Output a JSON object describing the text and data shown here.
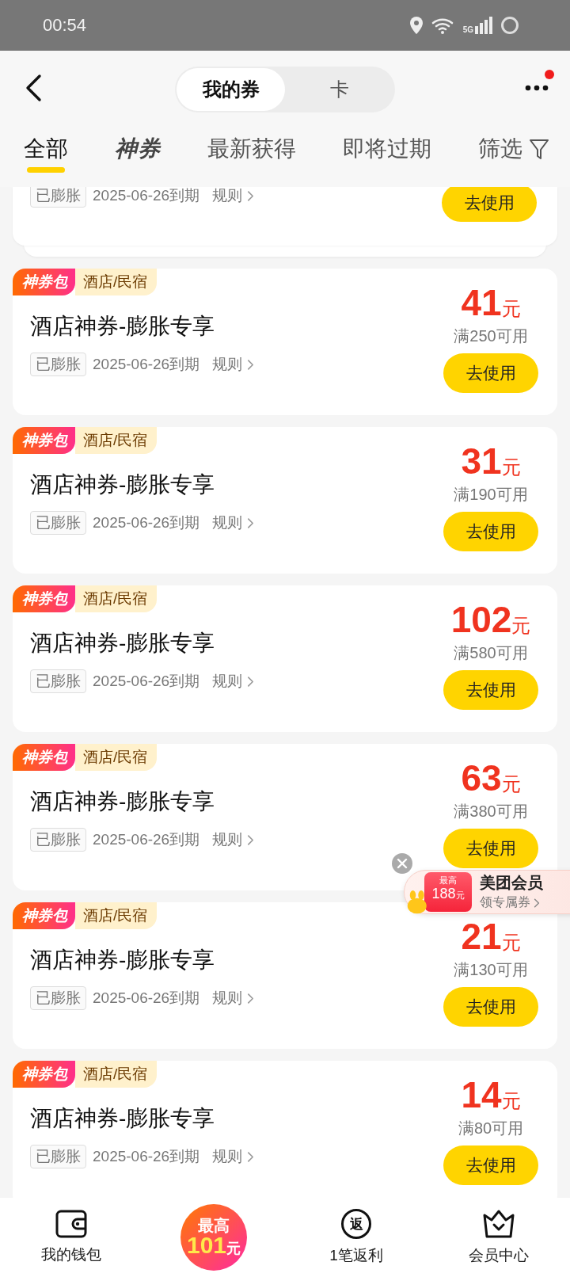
{
  "status_bar": {
    "time": "00:54",
    "network": "5G"
  },
  "header": {
    "segments": [
      {
        "label": "我的券",
        "selected": true
      },
      {
        "label": "卡",
        "selected": false
      }
    ],
    "more_badge": true
  },
  "tabs": [
    {
      "label": "全部",
      "selected": true,
      "kind": "text"
    },
    {
      "label": "神券",
      "selected": false,
      "kind": "logo"
    },
    {
      "label": "最新获得",
      "selected": false,
      "kind": "text"
    },
    {
      "label": "即将过期",
      "selected": false,
      "kind": "text"
    },
    {
      "label": "筛选",
      "selected": false,
      "kind": "filter"
    }
  ],
  "partial_coupon": {
    "badge": "已膨胀",
    "expiry": "2025-06-26到期",
    "rules": "规则",
    "button": "去使用"
  },
  "coupons": [
    {
      "pack": "神券包",
      "category": "酒店/民宿",
      "title": "酒店神券-膨胀专享",
      "badge": "已膨胀",
      "expiry": "2025-06-26到期",
      "rules": "规则",
      "amount": "41",
      "unit": "元",
      "condition": "满250可用",
      "button": "去使用"
    },
    {
      "pack": "神券包",
      "category": "酒店/民宿",
      "title": "酒店神券-膨胀专享",
      "badge": "已膨胀",
      "expiry": "2025-06-26到期",
      "rules": "规则",
      "amount": "31",
      "unit": "元",
      "condition": "满190可用",
      "button": "去使用"
    },
    {
      "pack": "神券包",
      "category": "酒店/民宿",
      "title": "酒店神券-膨胀专享",
      "badge": "已膨胀",
      "expiry": "2025-06-26到期",
      "rules": "规则",
      "amount": "102",
      "unit": "元",
      "condition": "满580可用",
      "button": "去使用"
    },
    {
      "pack": "神券包",
      "category": "酒店/民宿",
      "title": "酒店神券-膨胀专享",
      "badge": "已膨胀",
      "expiry": "2025-06-26到期",
      "rules": "规则",
      "amount": "63",
      "unit": "元",
      "condition": "满380可用",
      "button": "去使用"
    },
    {
      "pack": "神券包",
      "category": "酒店/民宿",
      "title": "酒店神券-膨胀专享",
      "badge": "已膨胀",
      "expiry": "2025-06-26到期",
      "rules": "规则",
      "amount": "21",
      "unit": "元",
      "condition": "满130可用",
      "button": "去使用"
    },
    {
      "pack": "神券包",
      "category": "酒店/民宿",
      "title": "酒店神券-膨胀专享",
      "badge": "已膨胀",
      "expiry": "2025-06-26到期",
      "rules": "规则",
      "amount": "14",
      "unit": "元",
      "condition": "满80可用",
      "button": "去使用"
    }
  ],
  "promo": {
    "badge_top": "最高",
    "badge_amount": "188",
    "badge_unit": "元",
    "title": "美团会员",
    "link": "领专属券"
  },
  "bottom_nav": [
    {
      "kind": "wallet",
      "label": "我的钱包"
    },
    {
      "kind": "promo",
      "top": "最高",
      "amount": "101",
      "unit": "元"
    },
    {
      "kind": "rebate",
      "icon_text": "返",
      "label": "1笔返利"
    },
    {
      "kind": "crown",
      "label": "会员中心"
    }
  ]
}
